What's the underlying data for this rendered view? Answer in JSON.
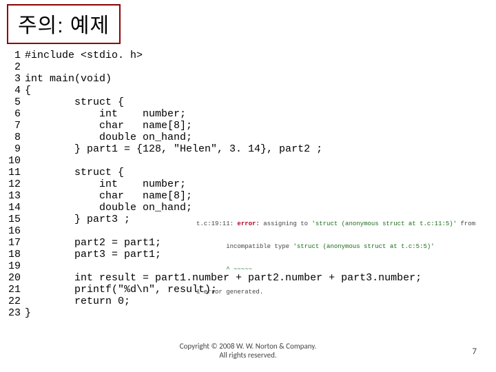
{
  "title": "주의: 예제",
  "code_lines": [
    {
      "n": "1",
      "t": "#include <stdio. h>"
    },
    {
      "n": "2",
      "t": ""
    },
    {
      "n": "3",
      "t": "int main(void)"
    },
    {
      "n": "4",
      "t": "{"
    },
    {
      "n": "5",
      "t": "        struct {"
    },
    {
      "n": "6",
      "t": "            int    number;"
    },
    {
      "n": "7",
      "t": "            char   name[8];"
    },
    {
      "n": "8",
      "t": "            double on_hand;"
    },
    {
      "n": "9",
      "t": "        } part1 = {128, \"Helen\", 3. 14}, part2 ;"
    },
    {
      "n": "10",
      "t": ""
    },
    {
      "n": "11",
      "t": "        struct {"
    },
    {
      "n": "12",
      "t": "            int    number;"
    },
    {
      "n": "13",
      "t": "            char   name[8];"
    },
    {
      "n": "14",
      "t": "            double on_hand;"
    },
    {
      "n": "15",
      "t": "        } part3 ;"
    },
    {
      "n": "16",
      "t": ""
    },
    {
      "n": "17",
      "t": "        part2 = part1;"
    },
    {
      "n": "18",
      "t": "        part3 = part1;"
    },
    {
      "n": "19",
      "t": ""
    },
    {
      "n": "20",
      "t": "        int result = part1.number + part2.number + part3.number;"
    },
    {
      "n": "21",
      "t": "        printf(\"%d\\n\", result);"
    },
    {
      "n": "22",
      "t": "        return 0;"
    },
    {
      "n": "23",
      "t": "}"
    }
  ],
  "error_msg": {
    "line1_pre": "t.c:19:11: ",
    "line1_err": "error:",
    "line1_mid": " assigning to ",
    "line1_ty1": "'struct (anonymous struct at t.c:11:5)'",
    "line1_post": " from",
    "line2_pre": "        incompatible type ",
    "line2_ty2": "'struct (anonymous struct at t.c:5:5)'",
    "line3": "        ^ ~~~~~",
    "line4": "1 error generated."
  },
  "footer": {
    "line1": "Copyright © 2008 W. W. Norton & Company.",
    "line2": "All rights reserved."
  },
  "page_number": "7"
}
